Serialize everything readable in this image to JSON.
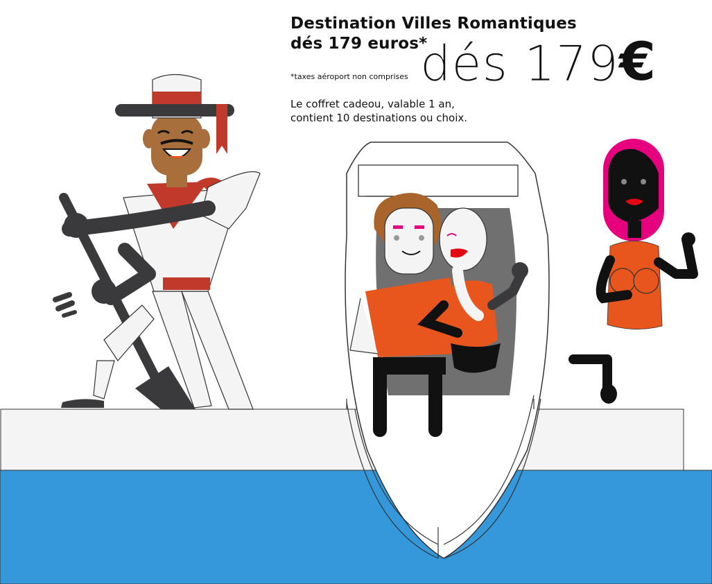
{
  "promo": {
    "title_line1": "Destination Villes Romantiques",
    "title_line2": "dés 179 euros*",
    "taxes_note": "*taxes aéroport non comprises",
    "big_price": "dés 179",
    "currency_symbol": "€",
    "gift_line1": "Le coffret cadeou, valable 1 an,",
    "gift_line2": "contient 10 destinations ou choix."
  },
  "colors": {
    "water": "#3598DB",
    "dock": "#F4F4F4",
    "orange": "#E8561E",
    "pink": "#E6007E",
    "red": "#C0392B",
    "dark": "#3A3A3C",
    "skin": "#A86F3D",
    "boat_inside": "#707070"
  }
}
